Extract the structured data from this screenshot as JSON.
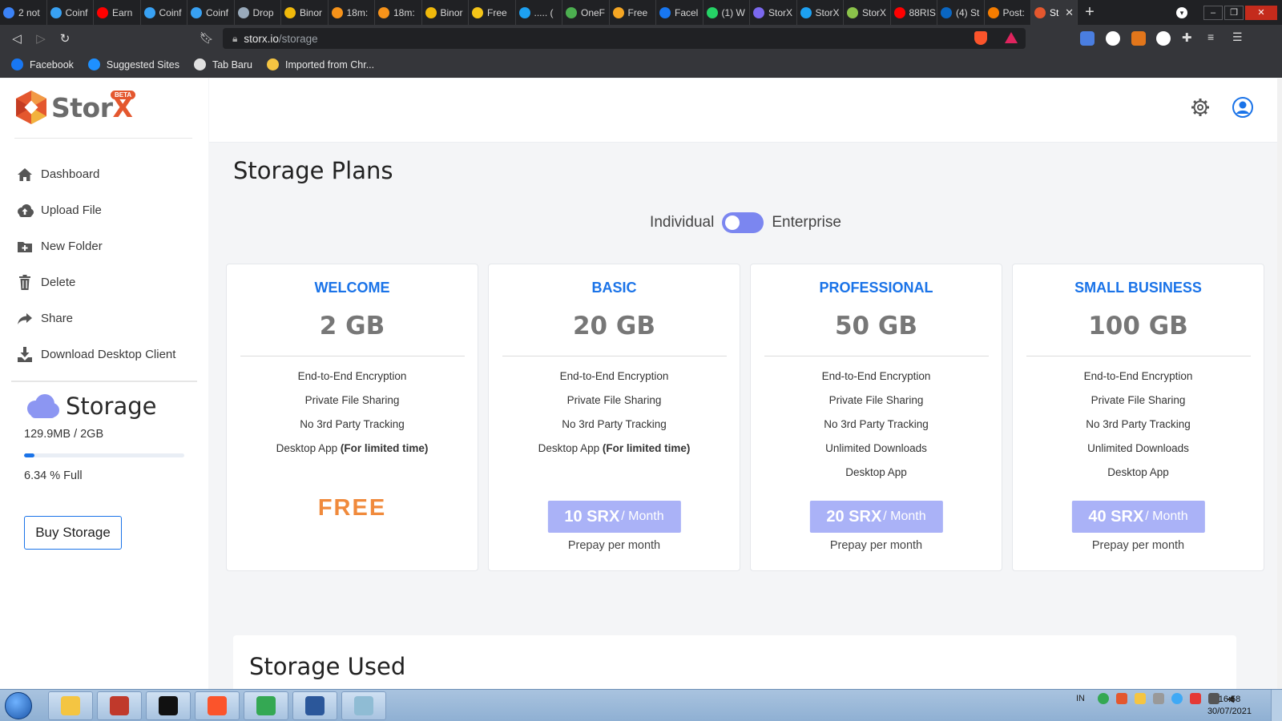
{
  "browser": {
    "tabs": [
      {
        "label": "2 not",
        "color": "#3b82f6"
      },
      {
        "label": "Coinf",
        "color": "#38a1f3"
      },
      {
        "label": "Earn",
        "color": "#ff0000"
      },
      {
        "label": "Coinf",
        "color": "#38a1f3"
      },
      {
        "label": "Coinf",
        "color": "#38a1f3"
      },
      {
        "label": "Drop",
        "color": "#9ab"
      },
      {
        "label": "Binor",
        "color": "#f0b90b"
      },
      {
        "label": "18m:",
        "color": "#f7931a"
      },
      {
        "label": "18m:",
        "color": "#f7931a"
      },
      {
        "label": "Binor",
        "color": "#f0b90b"
      },
      {
        "label": "Free",
        "color": "#f5c518"
      },
      {
        "label": "..... (",
        "color": "#1da1f2"
      },
      {
        "label": "OneF",
        "color": "#4caf50"
      },
      {
        "label": "Free",
        "color": "#f5a623"
      },
      {
        "label": "Facel",
        "color": "#1877f2"
      },
      {
        "label": "(1) W",
        "color": "#25d366"
      },
      {
        "label": "StorX",
        "color": "#7b68ee"
      },
      {
        "label": "StorX",
        "color": "#1da1f2"
      },
      {
        "label": "StorX",
        "color": "#8bc34a"
      },
      {
        "label": "88RIS",
        "color": "#ff0000"
      },
      {
        "label": "(4) St",
        "color": "#0a66c2"
      },
      {
        "label": "Post:",
        "color": "#f57c00"
      }
    ],
    "active_tab": {
      "label": "St",
      "color": "#e4572e"
    },
    "new_tab": "+",
    "url": {
      "domain": "storx.io",
      "path": "/storage"
    },
    "shield_badge": "1",
    "bookmarks": [
      {
        "label": "Facebook",
        "color": "#1877f2"
      },
      {
        "label": "Suggested Sites",
        "color": "#1e90ff"
      },
      {
        "label": "Tab Baru",
        "color": "#e0e0e0"
      },
      {
        "label": "Imported from Chr...",
        "color": "#f5c542"
      }
    ]
  },
  "app": {
    "logo": {
      "name_main": "Stor",
      "name_accent": "X",
      "badge": "BETA"
    },
    "menu": [
      {
        "label": "Dashboard",
        "icon": "home-icon"
      },
      {
        "label": "Upload File",
        "icon": "cloud-upload-icon"
      },
      {
        "label": "New Folder",
        "icon": "folder-plus-icon"
      },
      {
        "label": "Delete",
        "icon": "trash-icon"
      },
      {
        "label": "Share",
        "icon": "share-icon"
      },
      {
        "label": "Download Desktop Client",
        "icon": "download-icon"
      }
    ],
    "storage": {
      "title": "Storage",
      "used_text": "129.9MB / 2GB",
      "percent_text": "6.34 % Full",
      "percent": 6.34,
      "buy_label": "Buy Storage"
    },
    "page_title": "Storage Plans",
    "toggle": {
      "left_label": "Individual",
      "right_label": "Enterprise",
      "selected": "Individual"
    },
    "plans": [
      {
        "name": "WELCOME",
        "size": "2 GB",
        "features": [
          "End-to-End Encryption",
          "Private File Sharing",
          "No 3rd Party Tracking"
        ],
        "desktop_label": "Desktop App",
        "desktop_note": "(For limited time)",
        "free_label": "FREE"
      },
      {
        "name": "BASIC",
        "size": "20 GB",
        "features": [
          "End-to-End Encryption",
          "Private File Sharing",
          "No 3rd Party Tracking"
        ],
        "desktop_label": "Desktop App",
        "desktop_note": "(For limited time)",
        "price": "10 SRX",
        "price_unit": "/ Month",
        "prepay": "Prepay per month"
      },
      {
        "name": "PROFESSIONAL",
        "size": "50 GB",
        "features": [
          "End-to-End Encryption",
          "Private File Sharing",
          "No 3rd Party Tracking",
          "Unlimited Downloads",
          "Desktop App"
        ],
        "price": "20 SRX",
        "price_unit": "/ Month",
        "prepay": "Prepay per month"
      },
      {
        "name": "SMALL BUSINESS",
        "size": "100 GB",
        "features": [
          "End-to-End Encryption",
          "Private File Sharing",
          "No 3rd Party Tracking",
          "Unlimited Downloads",
          "Desktop App"
        ],
        "price": "40 SRX",
        "price_unit": "/ Month",
        "prepay": "Prepay per month"
      }
    ],
    "storage_used_title": "Storage Used"
  },
  "taskbar": {
    "language": "IN",
    "time": "16:58",
    "date": "30/07/2021",
    "apps": [
      {
        "name": "explorer",
        "color": "#f4c542"
      },
      {
        "name": "screen-recorder",
        "color": "#c0392b"
      },
      {
        "name": "cmd",
        "color": "#111111"
      },
      {
        "name": "brave",
        "color": "#fb542b"
      },
      {
        "name": "chrome",
        "color": "#34a853"
      },
      {
        "name": "word",
        "color": "#2b579a"
      },
      {
        "name": "notepad",
        "color": "#8fbcd4"
      }
    ]
  }
}
